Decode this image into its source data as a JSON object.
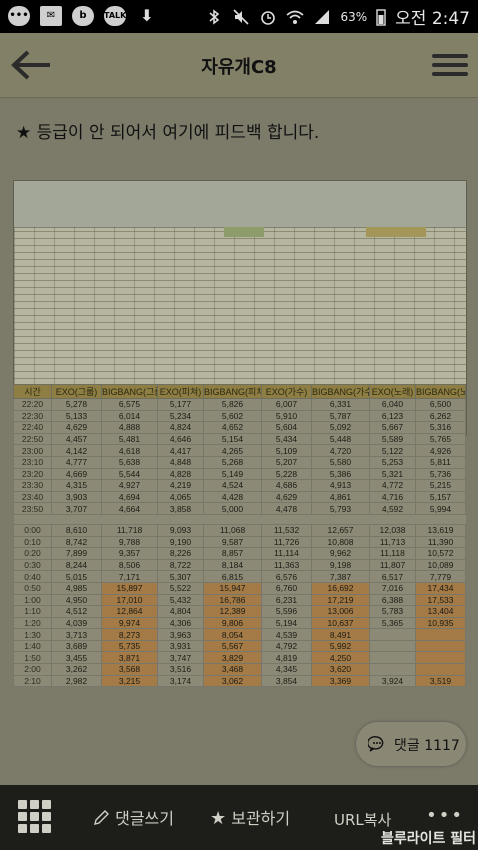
{
  "status_bar": {
    "left_icons": [
      "chat-bubble-icon",
      "mail-icon",
      "talk-icon",
      "talk-icon",
      "download-icon"
    ],
    "battery": "63%",
    "time": "오전 2:47"
  },
  "app_bar": {
    "title": "자유개C8"
  },
  "post": {
    "text": "★ 등급이 안 되어서 여기에 피드백 합니다."
  },
  "table": {
    "headers": [
      "시간",
      "EXO(그룹)",
      "BIGBANG(그룹)",
      "EXO(피쳐)",
      "BIGBANG(피쳐)",
      "EXO(가수)",
      "BIGBANG(가수)",
      "EXO(노래)",
      "BIGBANG(노래)"
    ],
    "block1": [
      [
        "22:20",
        "5,278",
        "6,575",
        "5,177",
        "5,826",
        "6,007",
        "6,331",
        "6,040",
        "6,500"
      ],
      [
        "22:30",
        "5,133",
        "6,014",
        "5,234",
        "5,602",
        "5,910",
        "5,787",
        "6,123",
        "6,262"
      ],
      [
        "22:40",
        "4,629",
        "4,888",
        "4,824",
        "4,652",
        "5,604",
        "5,092",
        "5,667",
        "5,316"
      ],
      [
        "22:50",
        "4,457",
        "5,481",
        "4,646",
        "5,154",
        "5,434",
        "5,448",
        "5,589",
        "5,765"
      ],
      [
        "23:00",
        "4,142",
        "4,618",
        "4,417",
        "4,265",
        "5,109",
        "4,720",
        "5,122",
        "4,926"
      ],
      [
        "23:10",
        "4,777",
        "5,638",
        "4,848",
        "5,268",
        "5,207",
        "5,580",
        "5,253",
        "5,811"
      ],
      [
        "23:20",
        "4,669",
        "5,544",
        "4,828",
        "5,149",
        "5,228",
        "5,386",
        "5,321",
        "5,736"
      ],
      [
        "23:30",
        "4,315",
        "4,927",
        "4,219",
        "4,524",
        "4,686",
        "4,913",
        "4,772",
        "5,215"
      ],
      [
        "23:40",
        "3,903",
        "4,694",
        "4,065",
        "4,428",
        "4,629",
        "4,861",
        "4,716",
        "5,157"
      ],
      [
        "23:50",
        "3,707",
        "4,664",
        "3,858",
        "5,000",
        "4,478",
        "5,793",
        "4,592",
        "5,994"
      ]
    ],
    "block2": [
      [
        "0:00",
        "8,610",
        "11,718",
        "9,093",
        "11,068",
        "11,532",
        "12,657",
        "12,038",
        "13,619"
      ],
      [
        "0:10",
        "8,742",
        "9,788",
        "9,190",
        "9,587",
        "11,726",
        "10,808",
        "11,713",
        "11,390"
      ],
      [
        "0:20",
        "7,899",
        "9,357",
        "8,226",
        "8,857",
        "11,114",
        "9,962",
        "11,118",
        "10,572"
      ],
      [
        "0:30",
        "8,244",
        "8,506",
        "8,722",
        "8,184",
        "11,363",
        "9,198",
        "11,807",
        "10,089"
      ],
      [
        "0:40",
        "5,015",
        "7,171",
        "5,307",
        "6,815",
        "6,576",
        "7,387",
        "6,517",
        "7,779"
      ],
      [
        "0:50",
        "4,985",
        "15,897",
        "5,522",
        "15,947",
        "6,760",
        "16,692",
        "7,016",
        "17,434"
      ],
      [
        "1:00",
        "4,950",
        "17,010",
        "5,432",
        "16,786",
        "6,231",
        "17,219",
        "6,388",
        "17,533"
      ],
      [
        "1:10",
        "4,512",
        "12,864",
        "4,804",
        "12,389",
        "5,596",
        "13,006",
        "5,783",
        "13,404"
      ],
      [
        "1:20",
        "4,039",
        "9,974",
        "4,306",
        "9,806",
        "5,194",
        "10,637",
        "5,365",
        "10,935"
      ],
      [
        "1:30",
        "3,713",
        "8,273",
        "3,963",
        "8,054",
        "4,539",
        "8,491",
        "",
        ""
      ],
      [
        "1:40",
        "3,689",
        "5,735",
        "3,931",
        "5,567",
        "4,792",
        "5,992",
        "",
        ""
      ],
      [
        "1:50",
        "3,455",
        "3,871",
        "3,747",
        "3,829",
        "4,819",
        "4,250",
        "",
        ""
      ],
      [
        "2:00",
        "3,262",
        "3,568",
        "3,516",
        "3,468",
        "4,345",
        "3,620",
        "",
        ""
      ],
      [
        "2:10",
        "2,982",
        "3,215",
        "3,174",
        "3,062",
        "3,854",
        "3,369",
        "3,924",
        "3,519"
      ]
    ],
    "highlight_rows": [
      "0:50",
      "1:00",
      "1:10",
      "1:20",
      "1:30",
      "1:40",
      "1:50",
      "2:00",
      "2:10"
    ]
  },
  "comment_button": {
    "label": "댓글 1117"
  },
  "bottom_bar": {
    "write_comment": "댓글쓰기",
    "save": "보관하기",
    "copy_url": "URL복사",
    "more": "•••",
    "filter_text": "블루라이트 필터"
  },
  "colors": {
    "status_bar": "#000000",
    "overlay_tint": "#7c7a68",
    "highlight": "#a47a46",
    "header": "#8f7e43",
    "bottom_bar": "#1d1d19"
  }
}
